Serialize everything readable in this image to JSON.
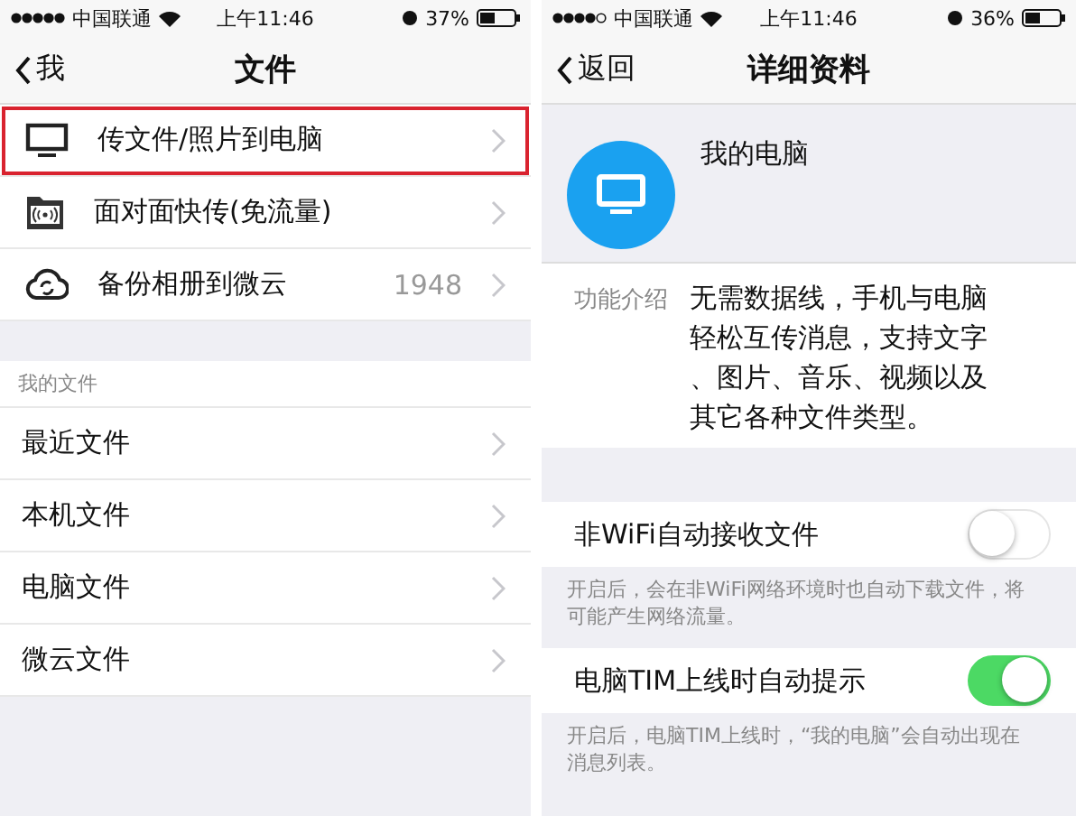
{
  "screens": [
    {
      "status_bar": {
        "carrier": "中国联通",
        "time": "上午11:46",
        "battery": "37%"
      },
      "nav": {
        "back": "我",
        "title": "文件"
      },
      "quick_items": [
        {
          "label": "传文件/照片到电脑",
          "highlighted": true
        },
        {
          "label": "面对面快传(免流量)",
          "highlighted": false
        },
        {
          "label": "备份相册到微云",
          "count": "1948",
          "highlighted": false
        }
      ],
      "section_header": "我的文件",
      "file_items": [
        {
          "label": "最近文件"
        },
        {
          "label": "本机文件"
        },
        {
          "label": "电脑文件"
        },
        {
          "label": "微云文件"
        }
      ]
    },
    {
      "status_bar": {
        "carrier": "中国联通",
        "time": "上午11:46",
        "battery": "36%"
      },
      "nav": {
        "back": "返回",
        "title": "详细资料"
      },
      "profile": {
        "name": "我的电脑"
      },
      "intro": {
        "label": "功能介绍",
        "text": "无需数据线，手机与电脑轻松互传消息，支持文字、图片、音乐、视频以及其它各种文件类型。"
      },
      "settings": [
        {
          "label": "非WiFi自动接收文件",
          "on": false,
          "note": "开启后，会在非WiFi网络环境时也自动下载文件，将可能产生网络流量。"
        },
        {
          "label": "电脑TIM上线时自动提示",
          "on": true,
          "note": "开启后，电脑TIM上线时，“我的电脑”会自动出现在消息列表。"
        }
      ]
    }
  ]
}
